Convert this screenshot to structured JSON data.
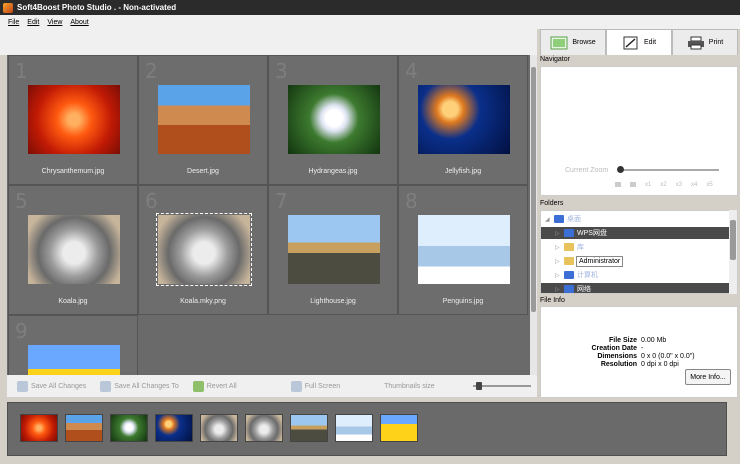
{
  "window": {
    "title": "Soft4Boost Photo Studio . - Non-activated"
  },
  "menu": [
    "File",
    "Edit",
    "View",
    "About"
  ],
  "tabs": [
    {
      "label": "Browse",
      "icon": "browse-icon",
      "active": false
    },
    {
      "label": "Edit",
      "icon": "edit-icon",
      "active": true
    },
    {
      "label": "Print",
      "icon": "printer-icon",
      "active": false
    }
  ],
  "thumbnails": [
    {
      "index": "1",
      "name": "Chrysanthemum.jpg",
      "style": "chrysanthemum"
    },
    {
      "index": "2",
      "name": "Desert.jpg",
      "style": "desert"
    },
    {
      "index": "3",
      "name": "Hydrangeas.jpg",
      "style": "hydrangeas"
    },
    {
      "index": "4",
      "name": "Jellyfish.jpg",
      "style": "jellyfish"
    },
    {
      "index": "5",
      "name": "Koala.jpg",
      "style": "koala"
    },
    {
      "index": "6",
      "name": "Koala.mky.png",
      "style": "koala",
      "selected": true
    },
    {
      "index": "7",
      "name": "Lighthouse.jpg",
      "style": "lighthouse"
    },
    {
      "index": "8",
      "name": "Penguins.jpg",
      "style": "penguins"
    },
    {
      "index": "9",
      "name": "",
      "style": "tulips"
    }
  ],
  "bottom_tools": {
    "save_all": "Save All Changes",
    "save_all_to": "Save All Changes To",
    "revert_all": "Revert All",
    "full_screen": "Full Screen",
    "thumbnails_size": "Thumbnails size"
  },
  "filmstrip": [
    "chrysanthemum",
    "desert",
    "hydrangeas",
    "jellyfish",
    "koala",
    "koala",
    "lighthouse",
    "penguins",
    "tulips"
  ],
  "navigator": {
    "title": "Navigator",
    "zoom_label": "Current Zoom",
    "zoom_buttons": [
      "x1",
      "x2",
      "x3",
      "x4",
      "x5"
    ]
  },
  "folders": {
    "title": "Folders",
    "items": [
      {
        "label": "桌面",
        "depth": 0,
        "icon": "desktop-icon",
        "selected": false,
        "blurred": true
      },
      {
        "label": "WPS网盘",
        "depth": 1,
        "icon": "cloud-drive-icon",
        "selected": true,
        "blurred": false
      },
      {
        "label": "库",
        "depth": 1,
        "icon": "library-icon",
        "selected": false,
        "blurred": true
      },
      {
        "label": "Administrator",
        "depth": 1,
        "icon": "user-folder-icon",
        "selected": false,
        "blurred": false
      },
      {
        "label": "计算机",
        "depth": 1,
        "icon": "computer-icon",
        "selected": false,
        "blurred": true
      },
      {
        "label": "网络",
        "depth": 1,
        "icon": "network-icon",
        "selected": true,
        "blurred": false
      }
    ],
    "tooltip": "Administrator"
  },
  "file_info": {
    "title": "File Info",
    "rows": [
      {
        "key": "File Size",
        "value": "0.00 Mb"
      },
      {
        "key": "Creation Date",
        "value": "-"
      },
      {
        "key": "Dimensions",
        "value": "0 x 0 (0.0\" x 0.0\")"
      },
      {
        "key": "Resolution",
        "value": "0 dpi x 0 dpi"
      }
    ],
    "more_button": "More Info..."
  }
}
